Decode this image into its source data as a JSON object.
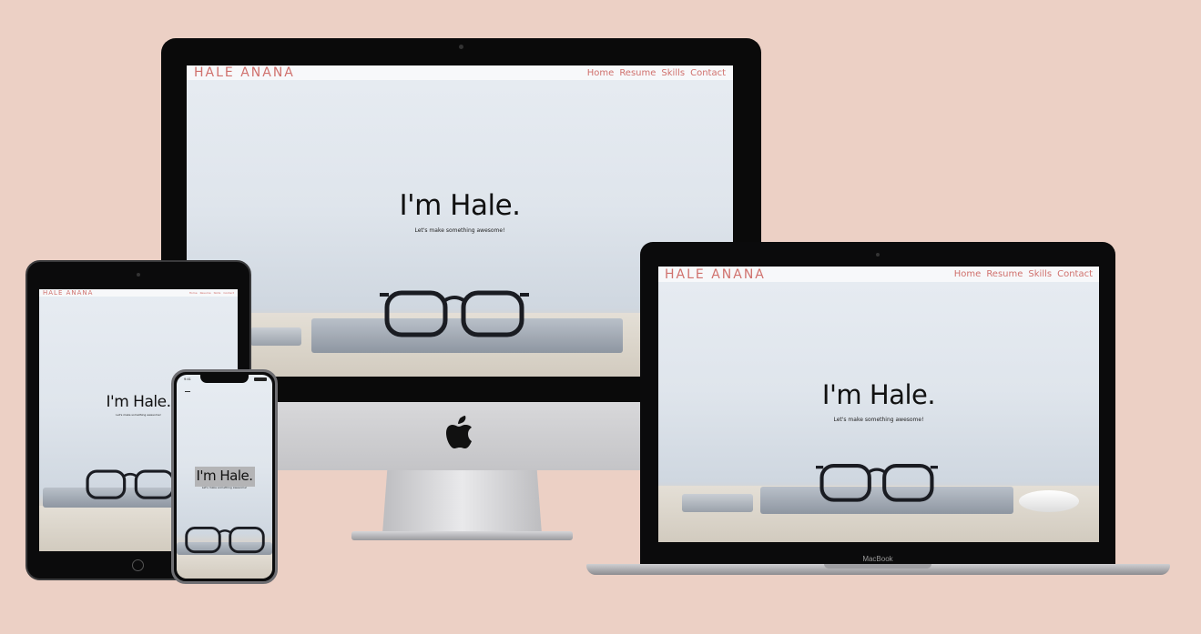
{
  "site": {
    "brand": "HALE ANANA",
    "nav": [
      "Home",
      "Resume",
      "Skills",
      "Contact"
    ],
    "hero_title": "I'm Hale.",
    "hero_subtitle": "Let's make something awesome!"
  },
  "devices": {
    "laptop_label": "MacBook",
    "phone_time": "9:41"
  },
  "colors": {
    "background": "#ecd0c5",
    "accent": "#d0716d"
  },
  "icons": [
    "apple-logo-icon",
    "glasses-icon",
    "home-button-icon"
  ]
}
